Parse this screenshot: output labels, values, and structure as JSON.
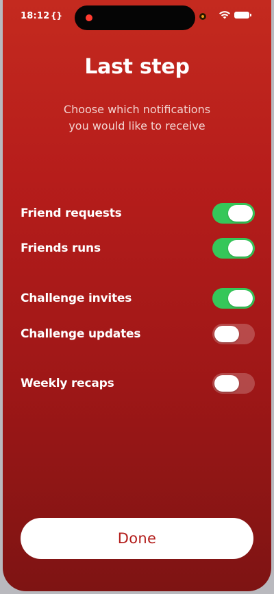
{
  "status_bar": {
    "time": "18:12",
    "dev_icon": "{}",
    "icons": [
      "recording-indicator-icon",
      "camera-indicator-icon",
      "wifi-icon",
      "battery-icon"
    ]
  },
  "title": "Last step",
  "subtitle_line1": "Choose which notifications",
  "subtitle_line2": "you would like to receive",
  "options": [
    {
      "label": "Friend requests",
      "enabled": true
    },
    {
      "label": "Friends runs",
      "enabled": true
    },
    {
      "label": "Challenge invites",
      "enabled": true
    },
    {
      "label": "Challenge updates",
      "enabled": false
    },
    {
      "label": "Weekly recaps",
      "enabled": false
    }
  ],
  "done_label": "Done",
  "colors": {
    "background_top": "#c42a1f",
    "background_bottom": "#7e1413",
    "toggle_on": "#35c759",
    "button_text": "#b31d1b"
  }
}
